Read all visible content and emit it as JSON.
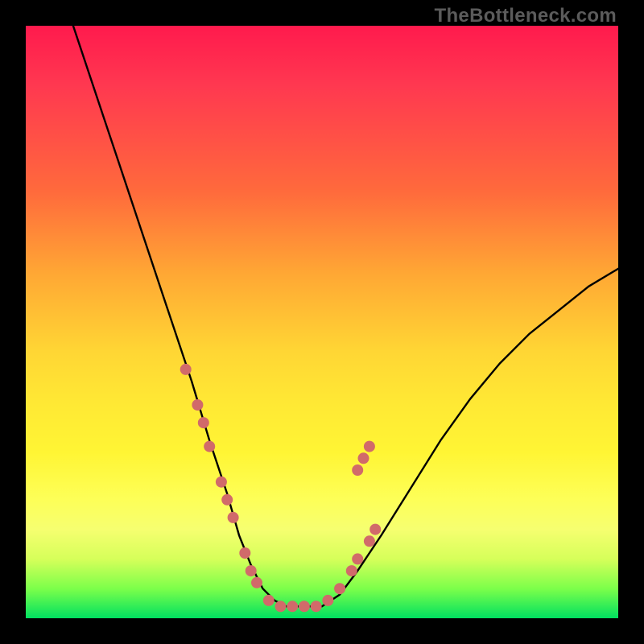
{
  "watermark": "TheBottleneck.com",
  "colors": {
    "frame": "#000000",
    "curve": "#000000",
    "dots": "#d16a6a",
    "gradient_stops": [
      "#ff1a4d",
      "#ff6a3c",
      "#ffd634",
      "#fdff58",
      "#00e060"
    ]
  },
  "chart_data": {
    "type": "line",
    "title": "",
    "xlabel": "",
    "ylabel": "",
    "xlim": [
      0,
      100
    ],
    "ylim": [
      0,
      100
    ],
    "grid": false,
    "series": [
      {
        "name": "bottleneck-curve",
        "x": [
          8,
          12,
          16,
          20,
          24,
          28,
          31,
          34,
          36,
          38,
          40,
          42,
          44,
          47,
          50,
          53,
          56,
          60,
          65,
          70,
          75,
          80,
          85,
          90,
          95,
          100
        ],
        "y": [
          100,
          88,
          76,
          64,
          52,
          40,
          30,
          21,
          14,
          9,
          5,
          3,
          2,
          2,
          2,
          4,
          8,
          14,
          22,
          30,
          37,
          43,
          48,
          52,
          56,
          59
        ]
      }
    ],
    "markers": [
      {
        "name": "left-cluster-dot",
        "x": 27,
        "y": 42
      },
      {
        "name": "left-cluster-dot",
        "x": 29,
        "y": 36
      },
      {
        "name": "left-cluster-dot",
        "x": 30,
        "y": 33
      },
      {
        "name": "left-cluster-dot",
        "x": 31,
        "y": 29
      },
      {
        "name": "left-cluster-dot",
        "x": 33,
        "y": 23
      },
      {
        "name": "left-cluster-dot",
        "x": 34,
        "y": 20
      },
      {
        "name": "left-cluster-dot",
        "x": 35,
        "y": 17
      },
      {
        "name": "left-cluster-dot",
        "x": 37,
        "y": 11
      },
      {
        "name": "left-cluster-dot",
        "x": 38,
        "y": 8
      },
      {
        "name": "left-cluster-dot",
        "x": 39,
        "y": 6
      },
      {
        "name": "bottom-dot",
        "x": 41,
        "y": 3
      },
      {
        "name": "bottom-dot",
        "x": 43,
        "y": 2
      },
      {
        "name": "bottom-dot",
        "x": 45,
        "y": 2
      },
      {
        "name": "bottom-dot",
        "x": 47,
        "y": 2
      },
      {
        "name": "bottom-dot",
        "x": 49,
        "y": 2
      },
      {
        "name": "bottom-dot",
        "x": 51,
        "y": 3
      },
      {
        "name": "right-cluster-dot",
        "x": 53,
        "y": 5
      },
      {
        "name": "right-cluster-dot",
        "x": 55,
        "y": 8
      },
      {
        "name": "right-cluster-dot",
        "x": 56,
        "y": 10
      },
      {
        "name": "right-cluster-dot",
        "x": 58,
        "y": 13
      },
      {
        "name": "right-cluster-dot",
        "x": 59,
        "y": 15
      },
      {
        "name": "right-cluster-dot",
        "x": 56,
        "y": 25
      },
      {
        "name": "right-cluster-dot",
        "x": 57,
        "y": 27
      },
      {
        "name": "right-cluster-dot",
        "x": 58,
        "y": 29
      }
    ]
  }
}
